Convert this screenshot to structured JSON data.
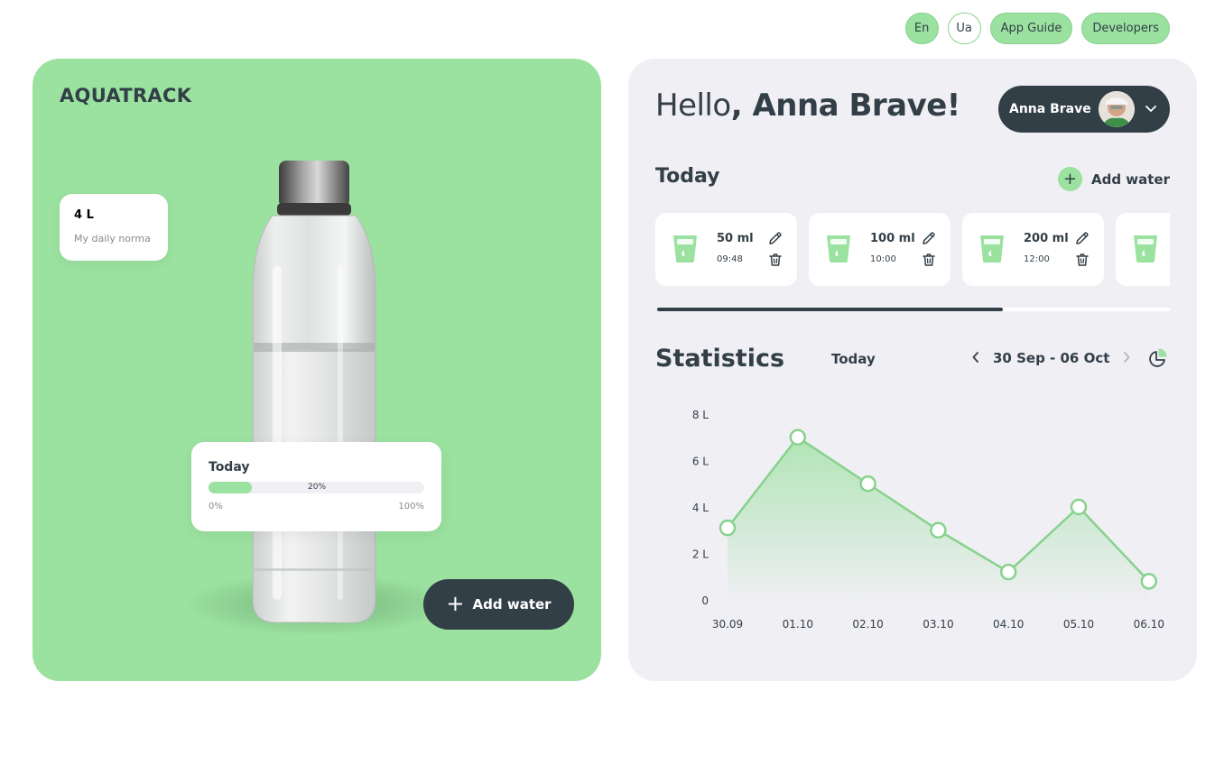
{
  "nav": {
    "lang_en": "En",
    "lang_ua": "Ua",
    "app_guide": "App Guide",
    "developers": "Developers"
  },
  "left": {
    "logo": "AQUATRACK",
    "daily_norma": {
      "value": "4 L",
      "label": "My daily norma"
    },
    "progress": {
      "title": "Today",
      "percent": 20,
      "percent_label": "20%",
      "min_label": "0%",
      "max_label": "100%"
    },
    "add_water_label": "Add water"
  },
  "right": {
    "greeting_prefix": "Hello",
    "greeting_name": ", Anna Brave!",
    "user_name": "Anna Brave",
    "today_title": "Today",
    "add_water_label": "Add water",
    "entries": [
      {
        "amount": "50 ml",
        "time": "09:48"
      },
      {
        "amount": "100 ml",
        "time": "10:00"
      },
      {
        "amount": "200 ml",
        "time": "12:00"
      },
      {
        "amount": "",
        "time": ""
      }
    ],
    "statistics_title": "Statistics",
    "statistics_period": "Today",
    "date_range": "30 Sep - 06 Oct"
  },
  "colors": {
    "accent_green": "#9be1a0",
    "dark": "#323f47",
    "panel_bg": "#f0eff4"
  },
  "chart_data": {
    "type": "area",
    "x": [
      "30.09",
      "01.10",
      "02.10",
      "03.10",
      "04.10",
      "05.10",
      "06.10"
    ],
    "values": [
      3.1,
      7.0,
      5.0,
      3.0,
      1.2,
      4.0,
      0.8
    ],
    "y_tick_labels": [
      "0",
      "2 L",
      "4 L",
      "6 L",
      "8 L"
    ],
    "y_ticks": [
      0,
      2,
      4,
      6,
      8
    ],
    "ylim": [
      0,
      8
    ],
    "grid": false,
    "line_color": "#87d28d"
  }
}
